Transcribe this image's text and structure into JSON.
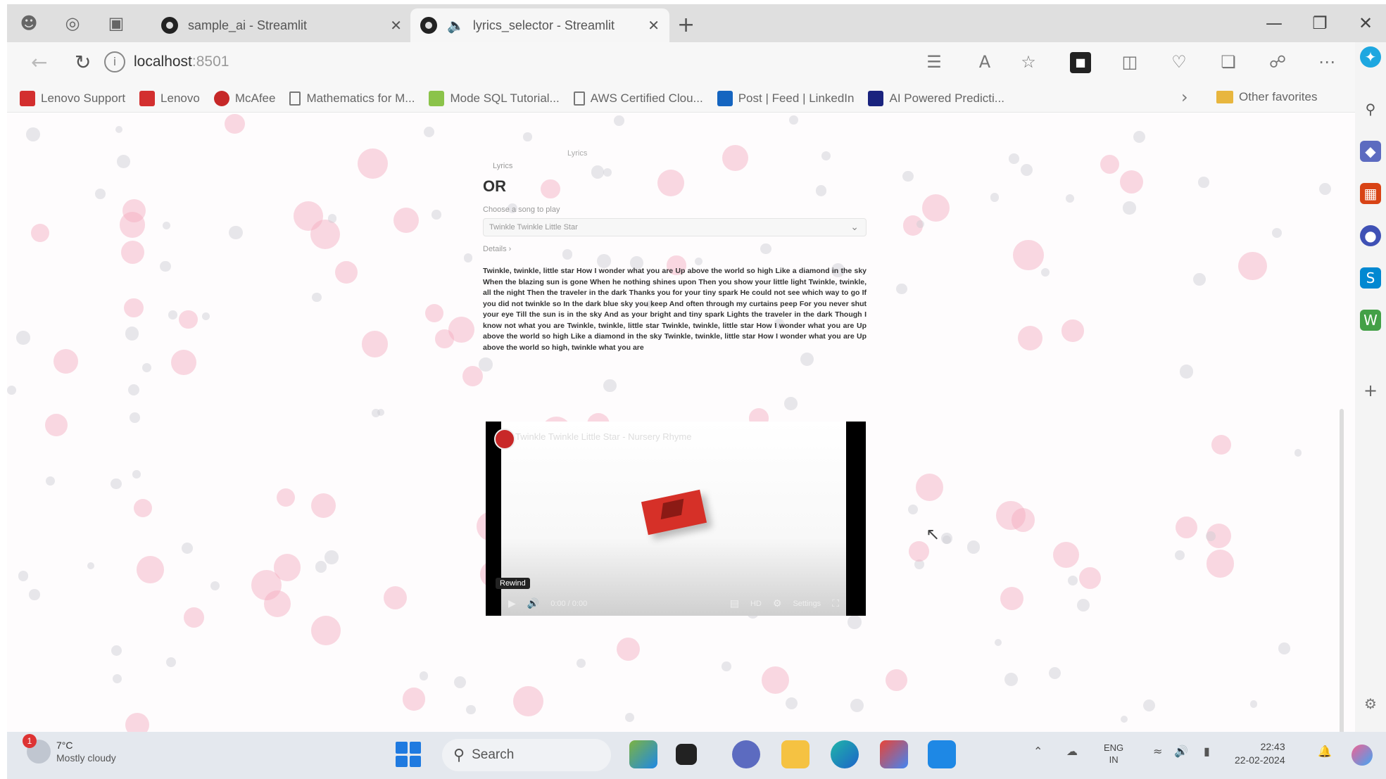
{
  "browser": {
    "tabs": [
      {
        "title": "sample_ai - Streamlit"
      },
      {
        "title": "lyrics_selector - Streamlit"
      }
    ],
    "url_host": "localhost",
    "url_port": ":8501",
    "bookmarks": [
      {
        "label": "Lenovo Support",
        "color": "#d32f2f"
      },
      {
        "label": "Lenovo",
        "color": "#d32f2f"
      },
      {
        "label": "McAfee",
        "color": "#c62828"
      },
      {
        "label": "Mathematics for M...",
        "color": ""
      },
      {
        "label": "Mode SQL Tutorial...",
        "color": "#8bc34a"
      },
      {
        "label": "AWS Certified Clou...",
        "color": ""
      },
      {
        "label": "Post | Feed | LinkedIn",
        "color": "#1565c0"
      },
      {
        "label": "AI Powered Predicti...",
        "color": "#1a237e"
      }
    ],
    "other_favorites": "Other favorites"
  },
  "page": {
    "crumb": "Lyrics",
    "small_label": "Lyrics",
    "heading": "OR",
    "field_label": "Choose a song to play",
    "select_value": "Twinkle Twinkle Little Star",
    "expander": "Details",
    "lyrics": "Twinkle, twinkle, little star How I wonder what you are Up above the world so high Like a diamond in the sky When the blazing sun is gone When he nothing shines upon Then you show your little light Twinkle, twinkle, all the night Then the traveler in the dark Thanks you for your tiny spark He could not see which way to go If you did not twinkle so In the dark blue sky you keep And often through my curtains peep For you never shut your eye Till the sun is in the sky And as your bright and tiny spark Lights the traveler in the dark Though I know not what you are Twinkle, twinkle, little star Twinkle, twinkle, little star How I wonder what you are Up above the world so high Like a diamond in the sky Twinkle, twinkle, little star How I wonder what you are Up above the world so high, twinkle what you are",
    "video": {
      "title": "Twinkle Twinkle Little Star - Nursery Rhyme",
      "tooltip": "Rewind",
      "time": "0:00 / 0:00",
      "quality": "HD",
      "settings": "Settings"
    }
  },
  "taskbar": {
    "weather_temp": "7°C",
    "weather_desc": "Mostly cloudy",
    "notification_count": "1",
    "search_placeholder": "Search",
    "lang": "ENG",
    "lang_region": "IN",
    "time": "22:43",
    "date": "22-02-2024"
  }
}
